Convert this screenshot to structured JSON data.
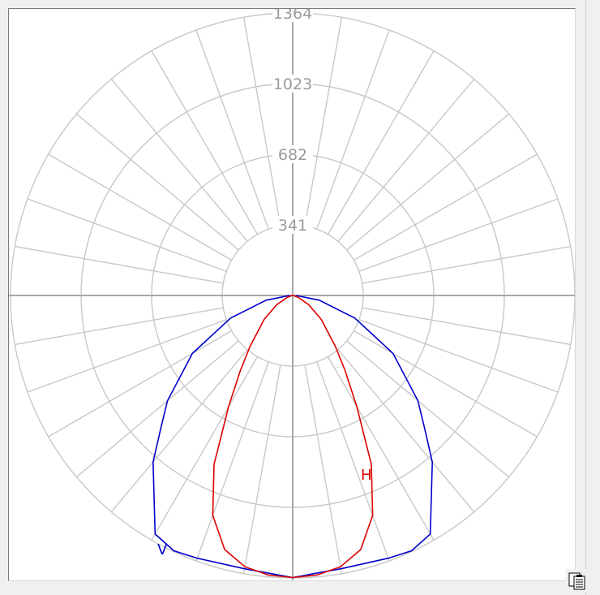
{
  "chart_data": {
    "type": "polar",
    "radial_ticks": [
      "341",
      "682",
      "1023",
      "1364"
    ],
    "r_max": 1364,
    "spoke_step_deg": 10,
    "grid": true,
    "colors": {
      "grid": "#c8c8c8",
      "axis": "#a8a8a8",
      "tick_label": "#9a9a9a"
    },
    "series": [
      {
        "name": "V",
        "color": "#0000cc",
        "angle_convention": "degrees from nadir (straight down), positive to the right",
        "points": [
          [
            -90,
            15
          ],
          [
            -80,
            130
          ],
          [
            -70,
            320
          ],
          [
            -60,
            560
          ],
          [
            -50,
            790
          ],
          [
            -45,
            900
          ],
          [
            -40,
            1050
          ],
          [
            -30,
            1330
          ],
          [
            -25,
            1360
          ],
          [
            -20,
            1350
          ],
          [
            -10,
            1340
          ],
          [
            0,
            1362
          ],
          [
            10,
            1340
          ],
          [
            20,
            1350
          ],
          [
            25,
            1360
          ],
          [
            30,
            1330
          ],
          [
            40,
            1050
          ],
          [
            45,
            900
          ],
          [
            50,
            790
          ],
          [
            60,
            560
          ],
          [
            70,
            320
          ],
          [
            80,
            130
          ],
          [
            90,
            15
          ]
        ]
      },
      {
        "name": "H",
        "color": "#dd0000",
        "angle_convention": "degrees from nadir (straight down), positive to the right",
        "points": [
          [
            -90,
            0
          ],
          [
            -80,
            5
          ],
          [
            -70,
            30
          ],
          [
            -60,
            90
          ],
          [
            -50,
            180
          ],
          [
            -40,
            320
          ],
          [
            -35,
            440
          ],
          [
            -30,
            620
          ],
          [
            -25,
            900
          ],
          [
            -20,
            1130
          ],
          [
            -15,
            1270
          ],
          [
            -10,
            1330
          ],
          [
            -5,
            1355
          ],
          [
            0,
            1362
          ],
          [
            5,
            1355
          ],
          [
            10,
            1330
          ],
          [
            15,
            1270
          ],
          [
            20,
            1130
          ],
          [
            25,
            900
          ],
          [
            30,
            620
          ],
          [
            35,
            440
          ],
          [
            40,
            320
          ],
          [
            50,
            180
          ],
          [
            60,
            90
          ],
          [
            70,
            30
          ],
          [
            80,
            5
          ],
          [
            90,
            0
          ]
        ]
      }
    ]
  },
  "series_labels": {
    "v": "V",
    "h": "H"
  },
  "toolbar": {
    "export_icon": "clipboard-list-icon"
  }
}
